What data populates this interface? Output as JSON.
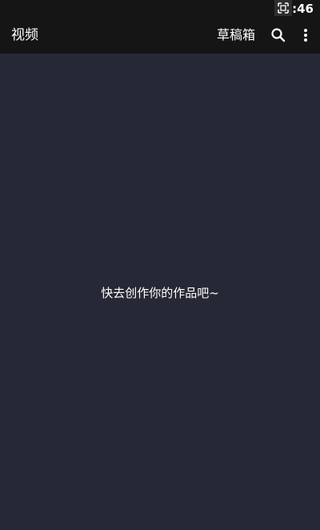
{
  "status_bar": {
    "time": ":46"
  },
  "app_bar": {
    "title": "视频",
    "drafts_label": "草稿箱",
    "search_icon": "search-icon",
    "more_icon": "more-vert-icon"
  },
  "main": {
    "empty_message": "快去创作你的作品吧~"
  },
  "colors": {
    "background": "#262935",
    "bar": "#151515",
    "text": "#ffffff"
  }
}
